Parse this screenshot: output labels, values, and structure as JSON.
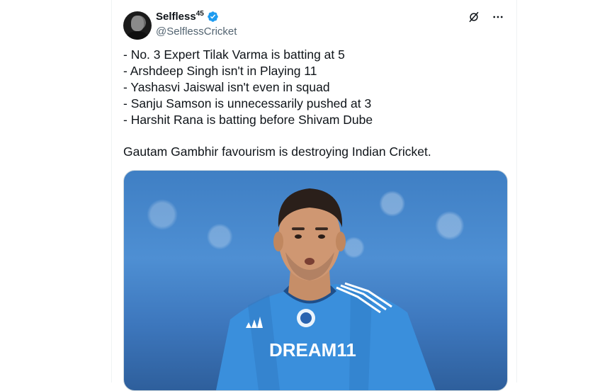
{
  "author": {
    "display_name": "Selfless",
    "display_name_sup": "45",
    "handle": "@SelflessCricket",
    "verified": true
  },
  "icons": {
    "verified": "verified-badge-icon",
    "grok": "grok-icon",
    "more": "more-options-icon"
  },
  "tweet": {
    "lines": [
      "- No. 3 Expert Tilak Varma is batting at 5",
      "- Arshdeep Singh isn't in Playing 11",
      "- Yashasvi Jaiswal isn't even in squad",
      "- Sanju Samson is unnecessarily pushed at 3",
      "- Harshit Rana is batting before Shivam Dube"
    ],
    "closing": "Gautam Gambhir favourism is destroying Indian Cricket."
  },
  "media": {
    "jersey_text": "DREAM11"
  },
  "colors": {
    "verified_blue": "#1d9bf0",
    "text_primary": "#0f1419",
    "text_secondary": "#536471"
  }
}
